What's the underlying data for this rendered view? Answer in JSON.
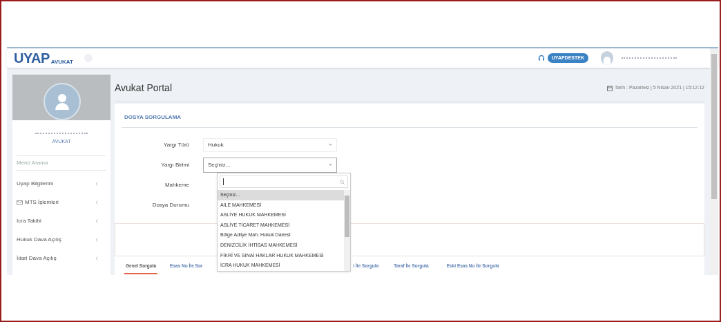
{
  "header": {
    "logo_main": "UYAP",
    "logo_sub": "AVUKAT",
    "support_badge": "UYAPDESTEK"
  },
  "sidebar": {
    "role": "AVUKAT",
    "search": {
      "placeholder": "Menü Arama"
    },
    "items": [
      {
        "label": "Uyap Bilgilerim",
        "has_icon": false
      },
      {
        "label": "MTS İşlemleri",
        "has_icon": true
      },
      {
        "label": "İcra Takibi",
        "has_icon": false
      },
      {
        "label": "Hukuk Dava Açılış",
        "has_icon": false
      },
      {
        "label": "İdari Dava Açılış",
        "has_icon": false
      }
    ]
  },
  "page": {
    "title": "Avukat Portal",
    "date": "Tarih : Pazartesi | 5 Nisan 2021 | 15:12:12"
  },
  "form": {
    "title": "DOSYA SORGULAMA",
    "fields": [
      {
        "label": "Yargı Türü",
        "value": "Hukuk",
        "kind": "select"
      },
      {
        "label": "Yargı Birimi",
        "value": "Seçiniz...",
        "kind": "select-open"
      },
      {
        "label": "Mahkeme",
        "kind": "hidden"
      },
      {
        "label": "Dosya Durumu",
        "kind": "hidden"
      }
    ]
  },
  "dropdown": {
    "options": [
      {
        "label": "Seçiniz...",
        "selected": true
      },
      {
        "label": "AİLE MAHKEMESİ",
        "selected": false
      },
      {
        "label": "ASLİYE HUKUK MAHKEMESİ",
        "selected": false
      },
      {
        "label": "ASLİYE TİCARET MAHKEMESİ",
        "selected": false
      },
      {
        "label": "Bölge Adliye Mah. Hukuk Dairesi",
        "selected": false
      },
      {
        "label": "DENİZCİLİK İHTİSAS MAHKEMESİ",
        "selected": false
      },
      {
        "label": "FİKRİ VE SINAİ HAKLAR HUKUK MAHKEMESİ",
        "selected": false
      },
      {
        "label": "İCRA HUKUK MAHKEMESİ",
        "selected": false
      }
    ]
  },
  "tabs": [
    {
      "label": "Genel Sorgula",
      "selected": true
    },
    {
      "label": "Esas No İle Sor",
      "selected": false
    },
    {
      "label": "i İle Sorgula",
      "selected": false
    },
    {
      "label": "Taraf İle Sorgula",
      "selected": false
    },
    {
      "label": "Eski Esas No İle Sorgula",
      "selected": false
    }
  ]
}
